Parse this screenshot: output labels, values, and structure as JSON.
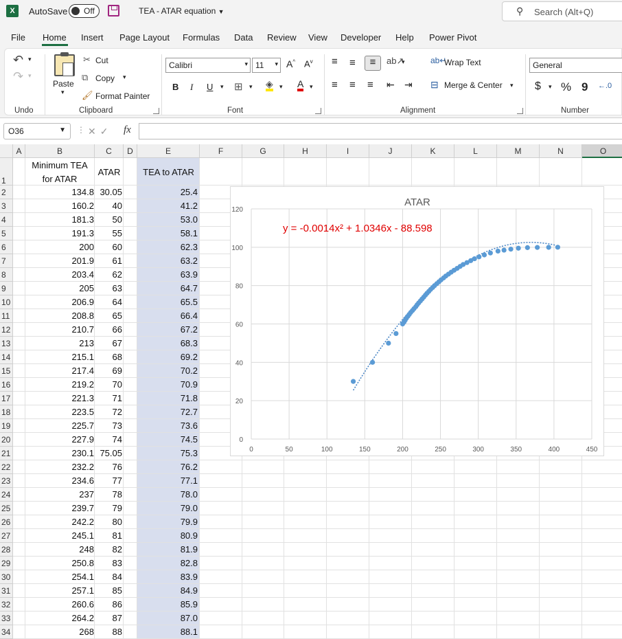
{
  "titlebar": {
    "app_icon": "X",
    "autosave_label": "AutoSave",
    "autosave_state": "Off",
    "document_title": "TEA - ATAR equation",
    "search_placeholder": "Search (Alt+Q)"
  },
  "menu": [
    "File",
    "Home",
    "Insert",
    "Page Layout",
    "Formulas",
    "Data",
    "Review",
    "View",
    "Developer",
    "Help",
    "Power Pivot"
  ],
  "ribbon": {
    "undo_group": "Undo",
    "clipboard": {
      "paste": "Paste",
      "cut": "Cut",
      "copy": "Copy",
      "format_painter": "Format Painter",
      "label": "Clipboard"
    },
    "font": {
      "name": "Calibri",
      "size": "11",
      "bold": "B",
      "italic": "I",
      "underline": "U",
      "label": "Font"
    },
    "alignment": {
      "wrap_text": "Wrap Text",
      "merge_center": "Merge & Center",
      "label": "Alignment"
    },
    "number": {
      "format": "General",
      "label": "Number",
      "currency": "$",
      "percent": "%",
      "comma": "9"
    }
  },
  "formula_bar": {
    "name_box": "O36",
    "fx": "fx",
    "formula": ""
  },
  "columns": [
    "A",
    "B",
    "C",
    "D",
    "E",
    "F",
    "G",
    "H",
    "I",
    "J",
    "K",
    "L",
    "M",
    "N",
    "O"
  ],
  "selected_column": "O",
  "header_row": {
    "b_line1": "Minimum TEA",
    "b_line2": "for ATAR",
    "c": "ATAR",
    "e": "TEA to ATAR"
  },
  "rows": [
    {
      "n": "1"
    },
    {
      "n": "2",
      "b": "134.8",
      "c": "30.05",
      "e": "25.4"
    },
    {
      "n": "3",
      "b": "160.2",
      "c": "40",
      "e": "41.2"
    },
    {
      "n": "4",
      "b": "181.3",
      "c": "50",
      "e": "53.0"
    },
    {
      "n": "5",
      "b": "191.3",
      "c": "55",
      "e": "58.1"
    },
    {
      "n": "6",
      "b": "200",
      "c": "60",
      "e": "62.3"
    },
    {
      "n": "7",
      "b": "201.9",
      "c": "61",
      "e": "63.2"
    },
    {
      "n": "8",
      "b": "203.4",
      "c": "62",
      "e": "63.9"
    },
    {
      "n": "9",
      "b": "205",
      "c": "63",
      "e": "64.7"
    },
    {
      "n": "10",
      "b": "206.9",
      "c": "64",
      "e": "65.5"
    },
    {
      "n": "11",
      "b": "208.8",
      "c": "65",
      "e": "66.4"
    },
    {
      "n": "12",
      "b": "210.7",
      "c": "66",
      "e": "67.2"
    },
    {
      "n": "13",
      "b": "213",
      "c": "67",
      "e": "68.3"
    },
    {
      "n": "14",
      "b": "215.1",
      "c": "68",
      "e": "69.2"
    },
    {
      "n": "15",
      "b": "217.4",
      "c": "69",
      "e": "70.2"
    },
    {
      "n": "16",
      "b": "219.2",
      "c": "70",
      "e": "70.9"
    },
    {
      "n": "17",
      "b": "221.3",
      "c": "71",
      "e": "71.8"
    },
    {
      "n": "18",
      "b": "223.5",
      "c": "72",
      "e": "72.7"
    },
    {
      "n": "19",
      "b": "225.7",
      "c": "73",
      "e": "73.6"
    },
    {
      "n": "20",
      "b": "227.9",
      "c": "74",
      "e": "74.5"
    },
    {
      "n": "21",
      "b": "230.1",
      "c": "75.05",
      "e": "75.3"
    },
    {
      "n": "22",
      "b": "232.2",
      "c": "76",
      "e": "76.2"
    },
    {
      "n": "23",
      "b": "234.6",
      "c": "77",
      "e": "77.1"
    },
    {
      "n": "24",
      "b": "237",
      "c": "78",
      "e": "78.0"
    },
    {
      "n": "25",
      "b": "239.7",
      "c": "79",
      "e": "79.0"
    },
    {
      "n": "26",
      "b": "242.2",
      "c": "80",
      "e": "79.9"
    },
    {
      "n": "27",
      "b": "245.1",
      "c": "81",
      "e": "80.9"
    },
    {
      "n": "28",
      "b": "248",
      "c": "82",
      "e": "81.9"
    },
    {
      "n": "29",
      "b": "250.8",
      "c": "83",
      "e": "82.8"
    },
    {
      "n": "30",
      "b": "254.1",
      "c": "84",
      "e": "83.9"
    },
    {
      "n": "31",
      "b": "257.1",
      "c": "85",
      "e": "84.9"
    },
    {
      "n": "32",
      "b": "260.6",
      "c": "86",
      "e": "85.9"
    },
    {
      "n": "33",
      "b": "264.2",
      "c": "87",
      "e": "87.0"
    },
    {
      "n": "34",
      "b": "268",
      "c": "88",
      "e": "88.1"
    }
  ],
  "chart_data": {
    "type": "scatter",
    "title": "ATAR",
    "trendline_label": "y = -0.0014x² + 1.0346x - 88.598",
    "trendline": {
      "a": -0.0014,
      "b": 1.0346,
      "c": -88.598,
      "x_range": [
        134.8,
        405
      ],
      "color": "#4a86c5"
    },
    "xlim": [
      0,
      450
    ],
    "ylim": [
      0,
      120
    ],
    "xticks": [
      0,
      50,
      100,
      150,
      200,
      250,
      300,
      350,
      400,
      450
    ],
    "yticks": [
      0,
      20,
      40,
      60,
      80,
      100,
      120
    ],
    "grid": true,
    "point_color": "#5b9bd5",
    "label_color": "#e00000",
    "points": [
      [
        134.8,
        30.05
      ],
      [
        160.2,
        40
      ],
      [
        181.3,
        50
      ],
      [
        191.3,
        55
      ],
      [
        200,
        60
      ],
      [
        201.9,
        61
      ],
      [
        203.4,
        62
      ],
      [
        205,
        63
      ],
      [
        206.9,
        64
      ],
      [
        208.8,
        65
      ],
      [
        210.7,
        66
      ],
      [
        213,
        67
      ],
      [
        215.1,
        68
      ],
      [
        217.4,
        69
      ],
      [
        219.2,
        70
      ],
      [
        221.3,
        71
      ],
      [
        223.5,
        72
      ],
      [
        225.7,
        73
      ],
      [
        227.9,
        74
      ],
      [
        230.1,
        75.05
      ],
      [
        232.2,
        76
      ],
      [
        234.6,
        77
      ],
      [
        237,
        78
      ],
      [
        239.7,
        79
      ],
      [
        242.2,
        80
      ],
      [
        245.1,
        81
      ],
      [
        248,
        82
      ],
      [
        250.8,
        83
      ],
      [
        254.1,
        84
      ],
      [
        257.1,
        85
      ],
      [
        260.6,
        86
      ],
      [
        264.2,
        87
      ],
      [
        268,
        88
      ],
      [
        272,
        89
      ],
      [
        276,
        90
      ],
      [
        280,
        91
      ],
      [
        285,
        92
      ],
      [
        290,
        93
      ],
      [
        295,
        94
      ],
      [
        301,
        95
      ],
      [
        308,
        96
      ],
      [
        316,
        97
      ],
      [
        326,
        98
      ],
      [
        334,
        98.5
      ],
      [
        343,
        99
      ],
      [
        353,
        99.5
      ],
      [
        365,
        99.8
      ],
      [
        378,
        99.9
      ],
      [
        393,
        99.95
      ],
      [
        405,
        100
      ]
    ]
  }
}
